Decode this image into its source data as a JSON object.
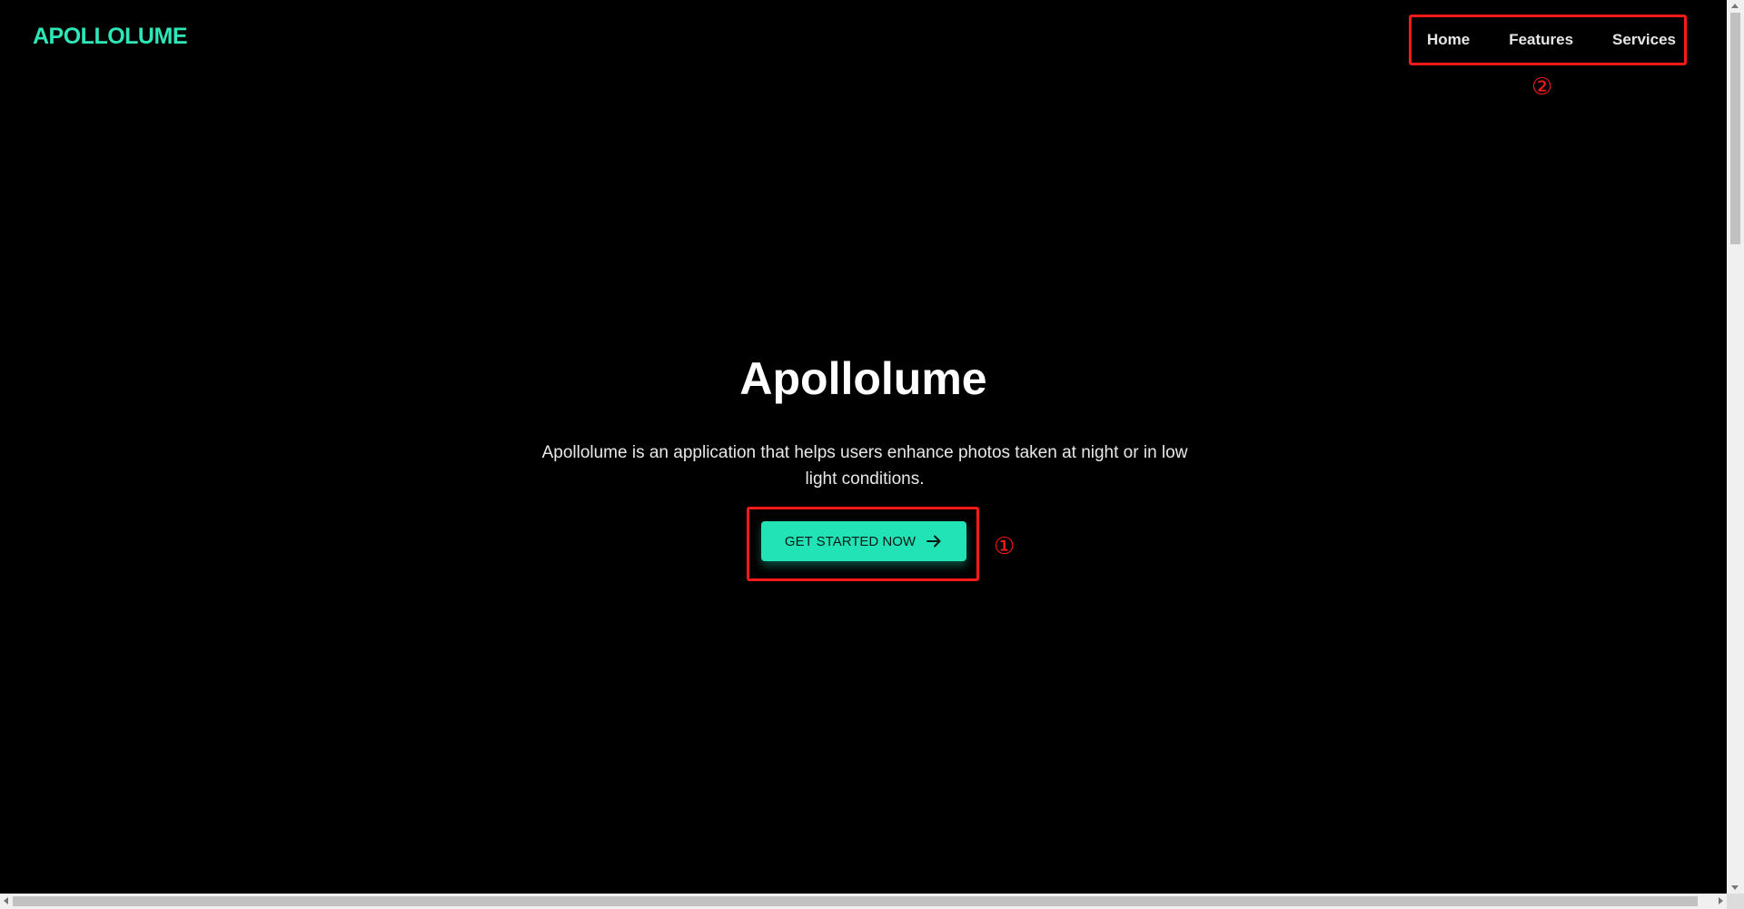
{
  "header": {
    "logo": "APOLLOLUME",
    "nav": [
      {
        "label": "Home"
      },
      {
        "label": "Features"
      },
      {
        "label": "Services"
      }
    ]
  },
  "hero": {
    "title": "Apollolume",
    "description": "Apollolume is an application that helps users enhance photos taken at night or in low light conditions.",
    "cta_label": "GET STARTED NOW",
    "cta_icon": "arrow-right-icon"
  },
  "annotations": {
    "marker_1": "①",
    "marker_2": "②"
  },
  "colors": {
    "background": "#000000",
    "accent": "#22e3b6",
    "annotation": "#ff1a1a"
  }
}
